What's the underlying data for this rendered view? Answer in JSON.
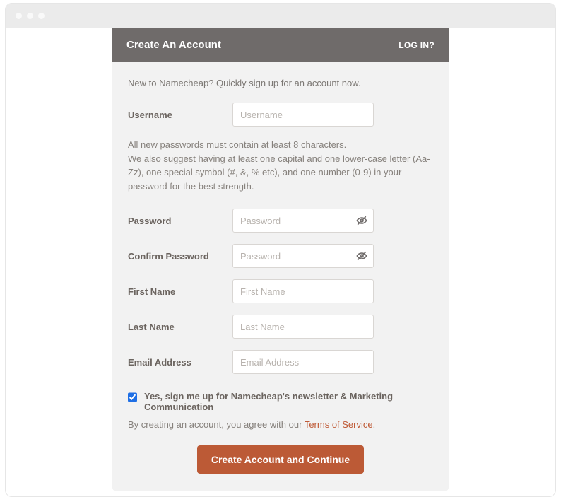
{
  "header": {
    "title": "Create An Account",
    "login_text": "LOG IN?"
  },
  "intro": "New to Namecheap? Quickly sign up for an account now.",
  "helper": "All new passwords must contain at least 8 characters.\nWe also suggest having at least one capital and one lower-case letter (Aa-Zz), one special symbol (#, &, % etc), and one number (0-9) in your password for the best strength.",
  "fields": {
    "username": {
      "label": "Username",
      "placeholder": "Username",
      "value": ""
    },
    "password": {
      "label": "Password",
      "placeholder": "Password",
      "value": ""
    },
    "confirm": {
      "label": "Confirm Password",
      "placeholder": "Password",
      "value": ""
    },
    "first": {
      "label": "First Name",
      "placeholder": "First Name",
      "value": ""
    },
    "last": {
      "label": "Last Name",
      "placeholder": "Last Name",
      "value": ""
    },
    "email": {
      "label": "Email Address",
      "placeholder": "Email Address",
      "value": ""
    }
  },
  "newsletter": {
    "checked": true,
    "label": "Yes, sign me up for Namecheap's newsletter & Marketing Communication"
  },
  "terms": {
    "prefix": "By creating an account, you agree with our ",
    "link_text": "Terms of Service",
    "suffix": "."
  },
  "submit_label": "Create Account and Continue"
}
